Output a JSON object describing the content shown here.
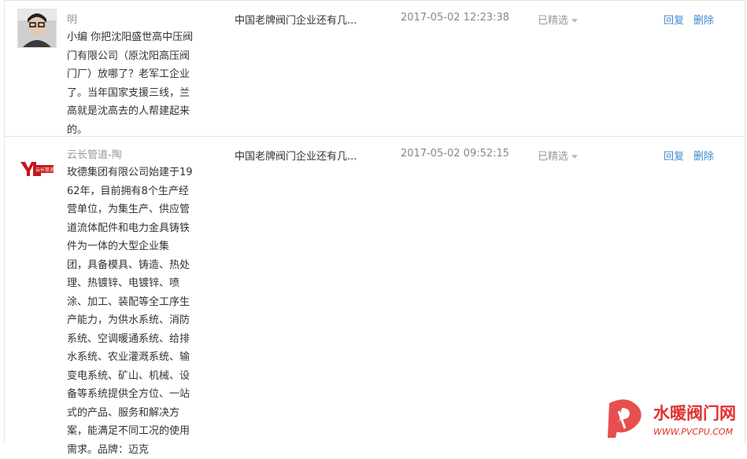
{
  "comments": [
    {
      "author": "明",
      "content": "小编 你把沈阳盛世高中压阀\n门有限公司（原沈阳高压阀\n门厂）放哪了？老军工企业\n了。当年国家支援三线，兰\n高就是沈高去的人帮建起来\n的。",
      "article_title": "中国老牌阀门企业还有几...",
      "time": "2017-05-02 12:23:38",
      "status": "已精选",
      "reply_label": "回复",
      "delete_label": "删除"
    },
    {
      "author": "云长管道-陶",
      "content": "玫德集团有限公司始建于19\n62年，目前拥有8个生产经\n营单位，为集生产、供应管\n道流体配件和电力金具铸铁\n件为一体的大型企业集\n团，具备模具、铸造、热处\n理、热镀锌、电镀锌、喷\n涂、加工、装配等全工序生\n产能力，为供水系统、消防\n系统、空调暖通系统、给排\n水系统、农业灌溉系统、输\n变电系统、矿山、机械、设\n备等系统提供全方位、一站\n式的产品、服务和解决方\n案，能满足不同工况的使用\n需求。品牌：迈克",
      "article_title": "中国老牌阀门企业还有几...",
      "time": "2017-05-02 09:52:15",
      "status": "已精选",
      "reply_label": "回复",
      "delete_label": "删除",
      "avatar_logo_text": "云长管道"
    }
  ],
  "watermark": {
    "name": "水暖阀门网",
    "url": "WWW.PVCPU.COM"
  }
}
